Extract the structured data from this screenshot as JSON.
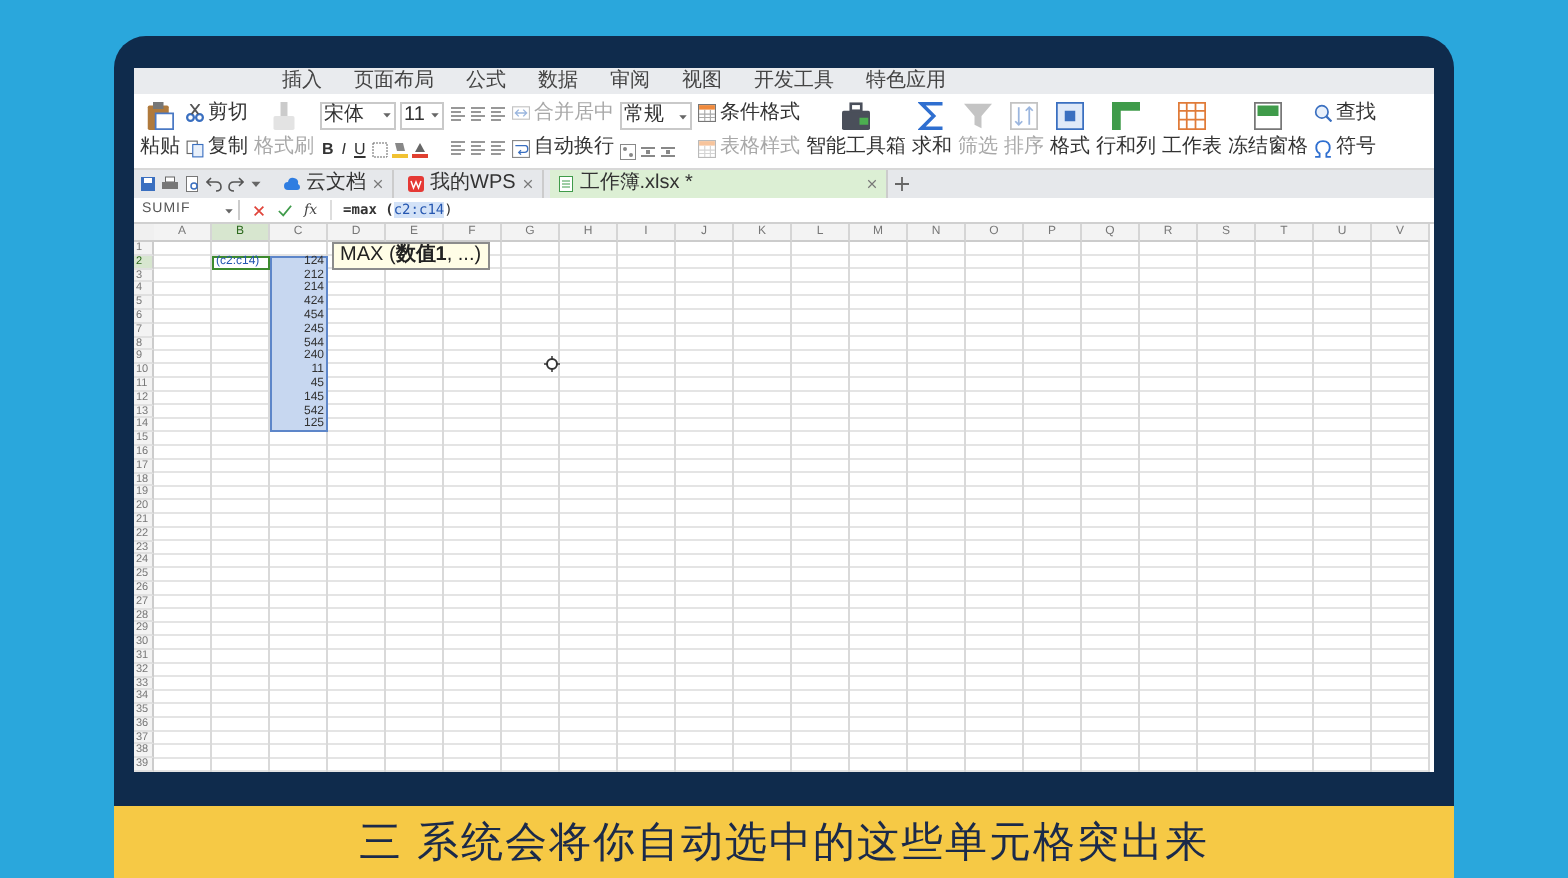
{
  "menu_tabs": [
    {
      "label": "插入",
      "selected": false
    },
    {
      "label": "页面布局",
      "selected": false
    },
    {
      "label": "公式",
      "selected": false
    },
    {
      "label": "数据",
      "selected": false
    },
    {
      "label": "审阅",
      "selected": false
    },
    {
      "label": "视图",
      "selected": false
    },
    {
      "label": "开发工具",
      "selected": false
    },
    {
      "label": "特色应用",
      "selected": false
    }
  ],
  "ribbon": {
    "items": [
      {
        "kind": "large",
        "label": "粘贴",
        "disabled": false
      },
      {
        "kind": "stacked",
        "label": "剪切",
        "disabled": false
      },
      {
        "kind": "stacked",
        "label": "复制",
        "disabled": false
      },
      {
        "kind": "large",
        "label": "格式刷",
        "disabled": true
      },
      {
        "kind": "font",
        "font": "宋体",
        "size": "11",
        "styles": [
          "B",
          "I",
          "U"
        ]
      },
      {
        "kind": "align"
      },
      {
        "kind": "stacked",
        "label": "合并居中",
        "disabled": true
      },
      {
        "kind": "stacked",
        "label": "自动换行",
        "disabled": false
      },
      {
        "kind": "number",
        "format": "常规"
      },
      {
        "kind": "stacked",
        "label": "条件格式",
        "disabled": false
      },
      {
        "kind": "stacked",
        "label": "表格样式",
        "disabled": true
      },
      {
        "kind": "large",
        "label": "智能工具箱",
        "disabled": false
      },
      {
        "kind": "large",
        "label": "求和",
        "disabled": false
      },
      {
        "kind": "large",
        "label": "筛选",
        "disabled": true
      },
      {
        "kind": "large",
        "label": "排序",
        "disabled": true
      },
      {
        "kind": "large",
        "label": "格式",
        "disabled": false
      },
      {
        "kind": "large",
        "label": "行和列",
        "disabled": false
      },
      {
        "kind": "large",
        "label": "工作表",
        "disabled": false
      },
      {
        "kind": "large",
        "label": "冻结窗格",
        "disabled": false
      },
      {
        "kind": "stacked",
        "label": "查找",
        "disabled": false
      },
      {
        "kind": "stacked",
        "label": "符号",
        "disabled": false
      }
    ]
  },
  "document_tabs": [
    {
      "label": "云文档",
      "selected": false
    },
    {
      "label": "我的WPS",
      "selected": false
    },
    {
      "label": "工作簿.xlsx *",
      "selected": true
    }
  ],
  "formula_bar": {
    "name_box": "SUMIF",
    "function_label": "fx",
    "formula": {
      "start": "=max (",
      "reference": "c2:c14",
      "end": ")"
    }
  },
  "sheet": {
    "columns": [
      {
        "label": "A",
        "selected": false
      },
      {
        "label": "B",
        "selected": true
      },
      {
        "label": "C",
        "selected": false
      },
      {
        "label": "D",
        "selected": false
      },
      {
        "label": "E",
        "selected": false
      },
      {
        "label": "F",
        "selected": false
      },
      {
        "label": "G",
        "selected": false
      },
      {
        "label": "H",
        "selected": false
      },
      {
        "label": "I",
        "selected": false
      },
      {
        "label": "J",
        "selected": false
      },
      {
        "label": "K",
        "selected": false
      },
      {
        "label": "L",
        "selected": false
      },
      {
        "label": "M",
        "selected": false
      },
      {
        "label": "N",
        "selected": false
      },
      {
        "label": "O",
        "selected": false
      },
      {
        "label": "P",
        "selected": false
      },
      {
        "label": "Q",
        "selected": false
      },
      {
        "label": "R",
        "selected": false
      },
      {
        "label": "S",
        "selected": false
      },
      {
        "label": "T",
        "selected": false
      },
      {
        "label": "U",
        "selected": false
      },
      {
        "label": "V",
        "selected": false
      }
    ],
    "rows": [
      {
        "label": "1",
        "selected": false
      },
      {
        "label": "2",
        "selected": true
      },
      {
        "label": "3",
        "selected": false
      },
      {
        "label": "4",
        "selected": false
      },
      {
        "label": "5",
        "selected": false
      },
      {
        "label": "6",
        "selected": false
      },
      {
        "label": "7",
        "selected": false
      },
      {
        "label": "8",
        "selected": false
      },
      {
        "label": "9",
        "selected": false
      },
      {
        "label": "10",
        "selected": false
      },
      {
        "label": "11",
        "selected": false
      },
      {
        "label": "12",
        "selected": false
      },
      {
        "label": "13",
        "selected": false
      },
      {
        "label": "14",
        "selected": false
      },
      {
        "label": "15",
        "selected": false
      },
      {
        "label": "16",
        "selected": false
      },
      {
        "label": "17",
        "selected": false
      },
      {
        "label": "18",
        "selected": false
      },
      {
        "label": "19",
        "selected": false
      },
      {
        "label": "20",
        "selected": false
      },
      {
        "label": "21",
        "selected": false
      },
      {
        "label": "22",
        "selected": false
      },
      {
        "label": "23",
        "selected": false
      },
      {
        "label": "24",
        "selected": false
      },
      {
        "label": "25",
        "selected": false
      },
      {
        "label": "26",
        "selected": false
      },
      {
        "label": "27",
        "selected": false
      },
      {
        "label": "28",
        "selected": false
      },
      {
        "label": "29",
        "selected": false
      },
      {
        "label": "30",
        "selected": false
      },
      {
        "label": "31",
        "selected": false
      },
      {
        "label": "32",
        "selected": false
      },
      {
        "label": "33",
        "selected": false
      },
      {
        "label": "34",
        "selected": false
      },
      {
        "label": "35",
        "selected": false
      },
      {
        "label": "36",
        "selected": false
      },
      {
        "label": "37",
        "selected": false
      },
      {
        "label": "38",
        "selected": false
      },
      {
        "label": "39",
        "selected": false
      }
    ],
    "active_cell": "(c2:c14)",
    "highlighted_values": [
      "124",
      "212",
      "214",
      "424",
      "454",
      "245",
      "544",
      "240",
      "11",
      "45",
      "145",
      "542",
      "125"
    ],
    "tooltip": "MAX (**数值1**, ...)"
  },
  "caption": "三 系统会将你自动选中的这些单元格突出来"
}
